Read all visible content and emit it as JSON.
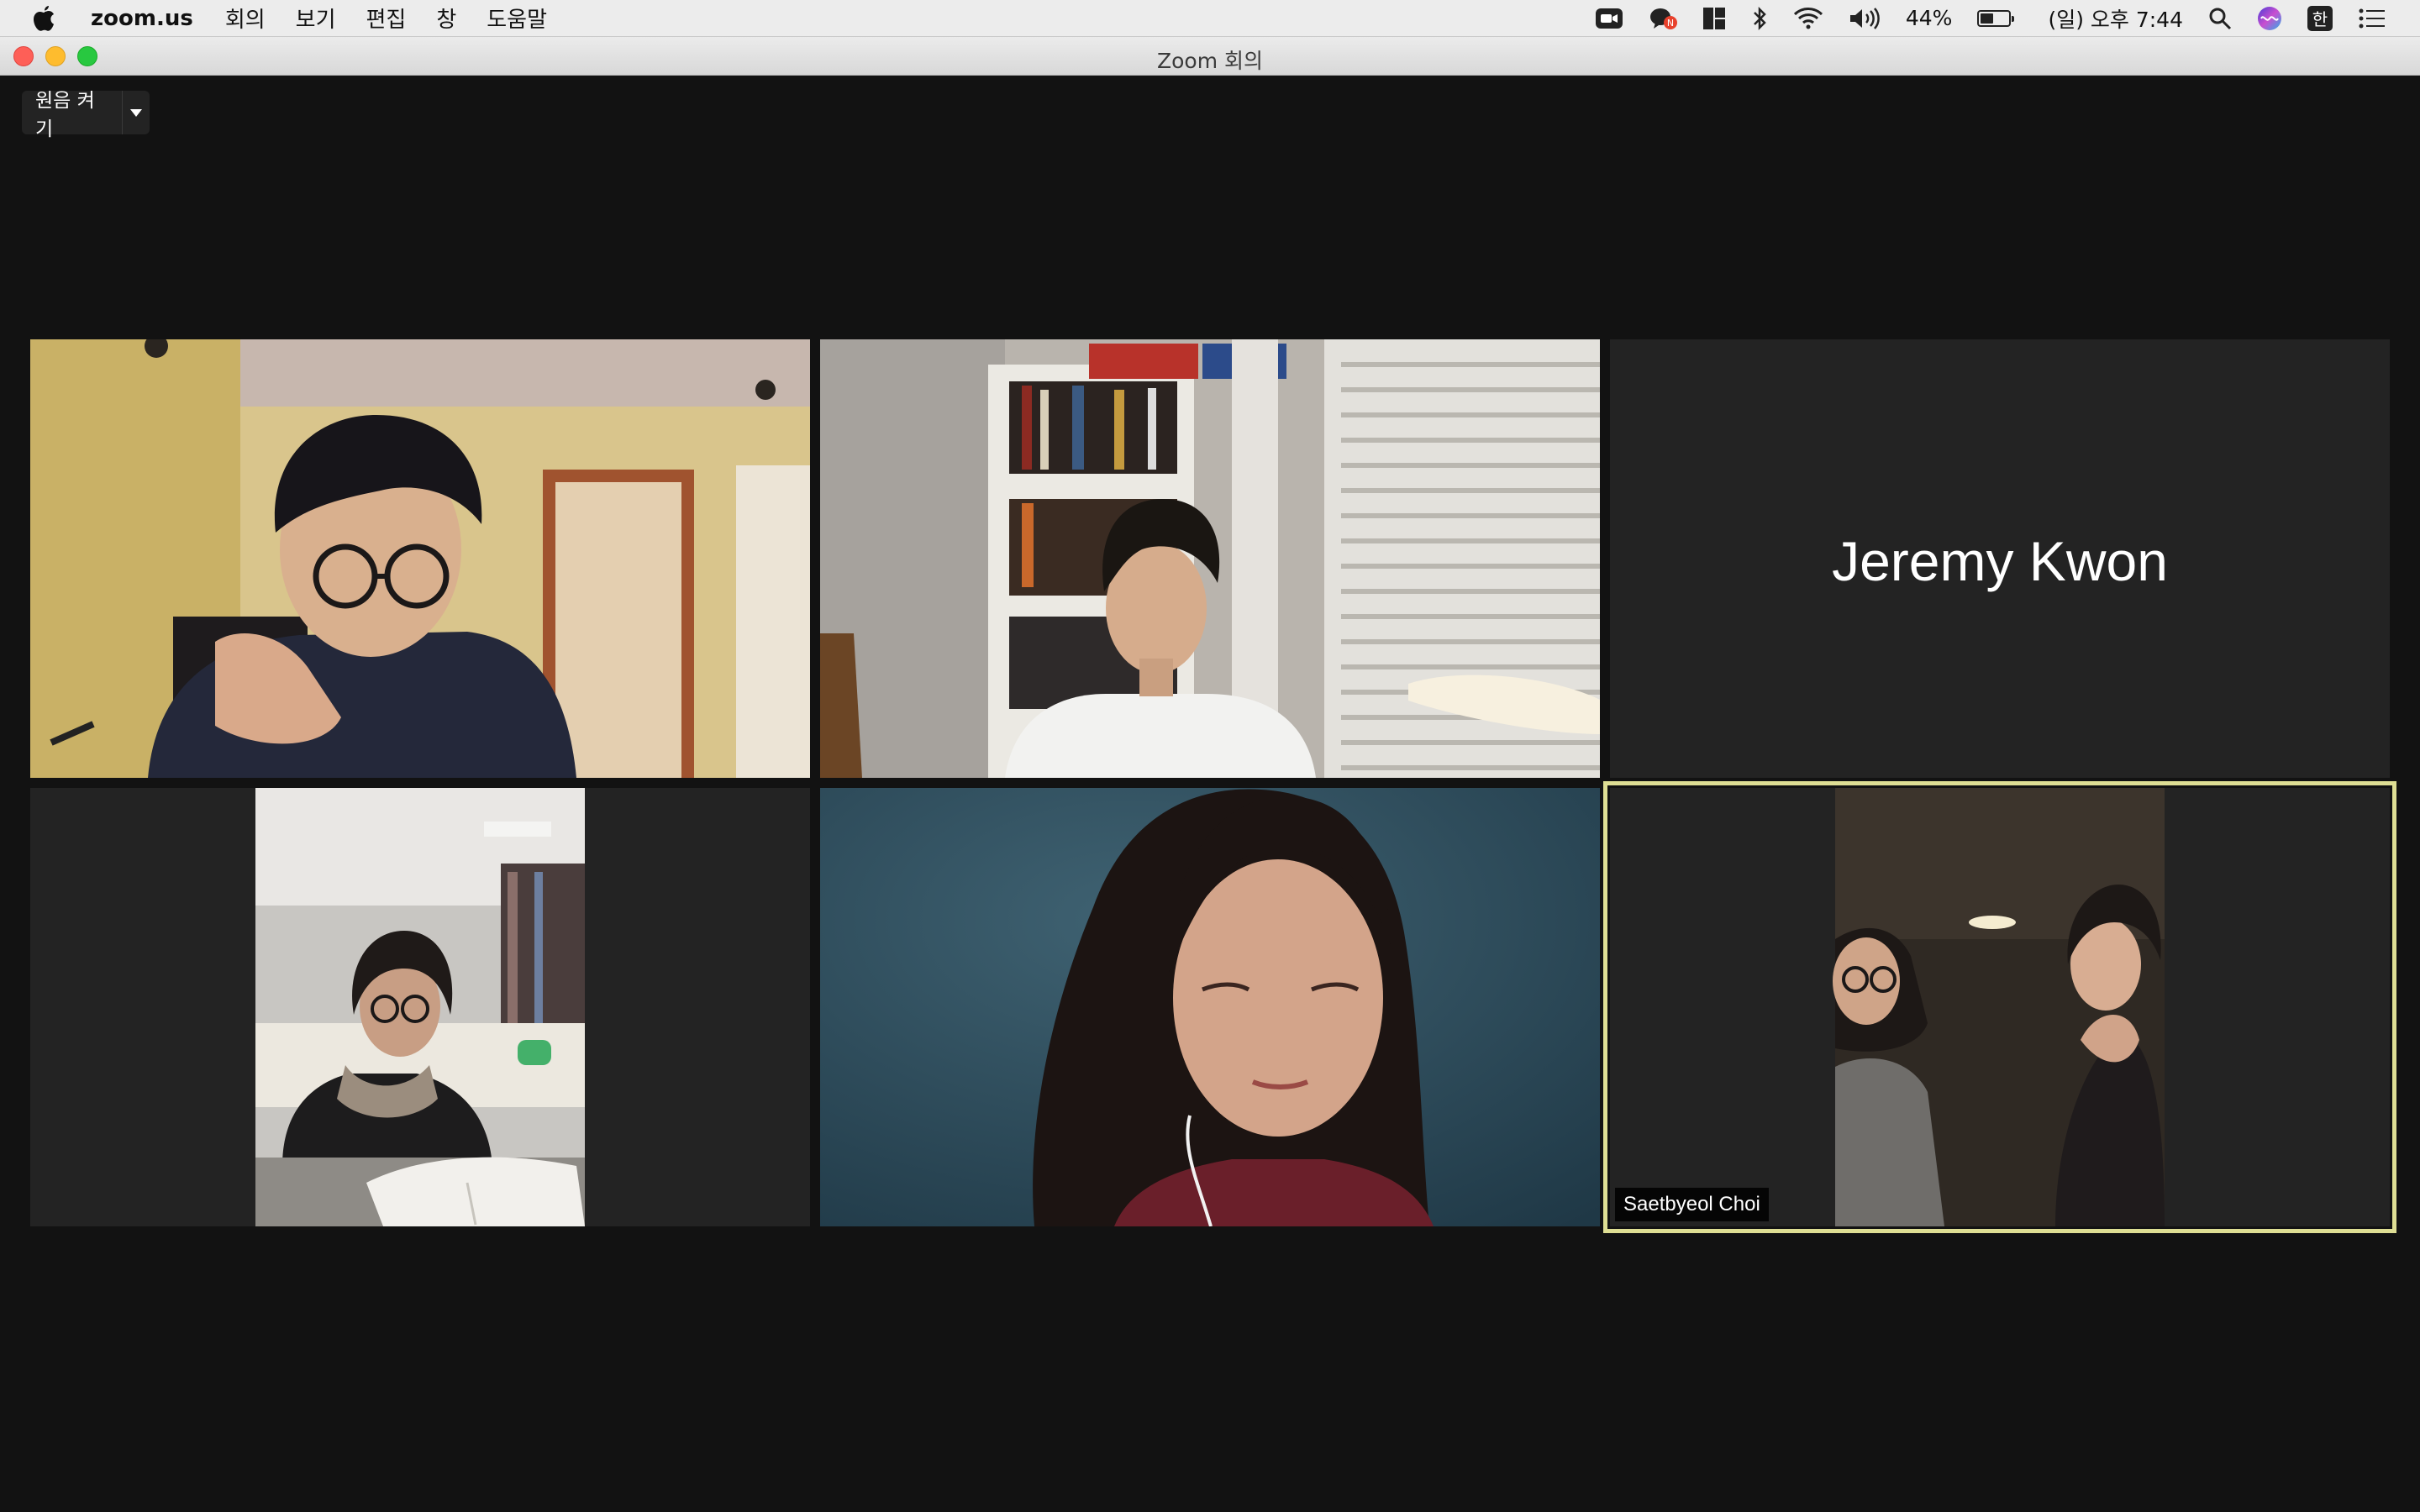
{
  "menubar": {
    "app_name": "zoom.us",
    "menus": [
      "회의",
      "보기",
      "편집",
      "창",
      "도움말"
    ],
    "battery_percent": "44%",
    "battery_level": 0.44,
    "clock": "(일) 오후 7:44",
    "ime": "한"
  },
  "window": {
    "title": "Zoom 회의"
  },
  "toolbar": {
    "original_sound_label": "원음 켜기"
  },
  "participants": {
    "jeremy_name": "Jeremy Kwon",
    "active_speaker_name": "Saetbyeol Choi"
  },
  "colors": {
    "active_speaker_border": "#dede94",
    "tile_background": "#232323",
    "window_background": "#121212"
  }
}
